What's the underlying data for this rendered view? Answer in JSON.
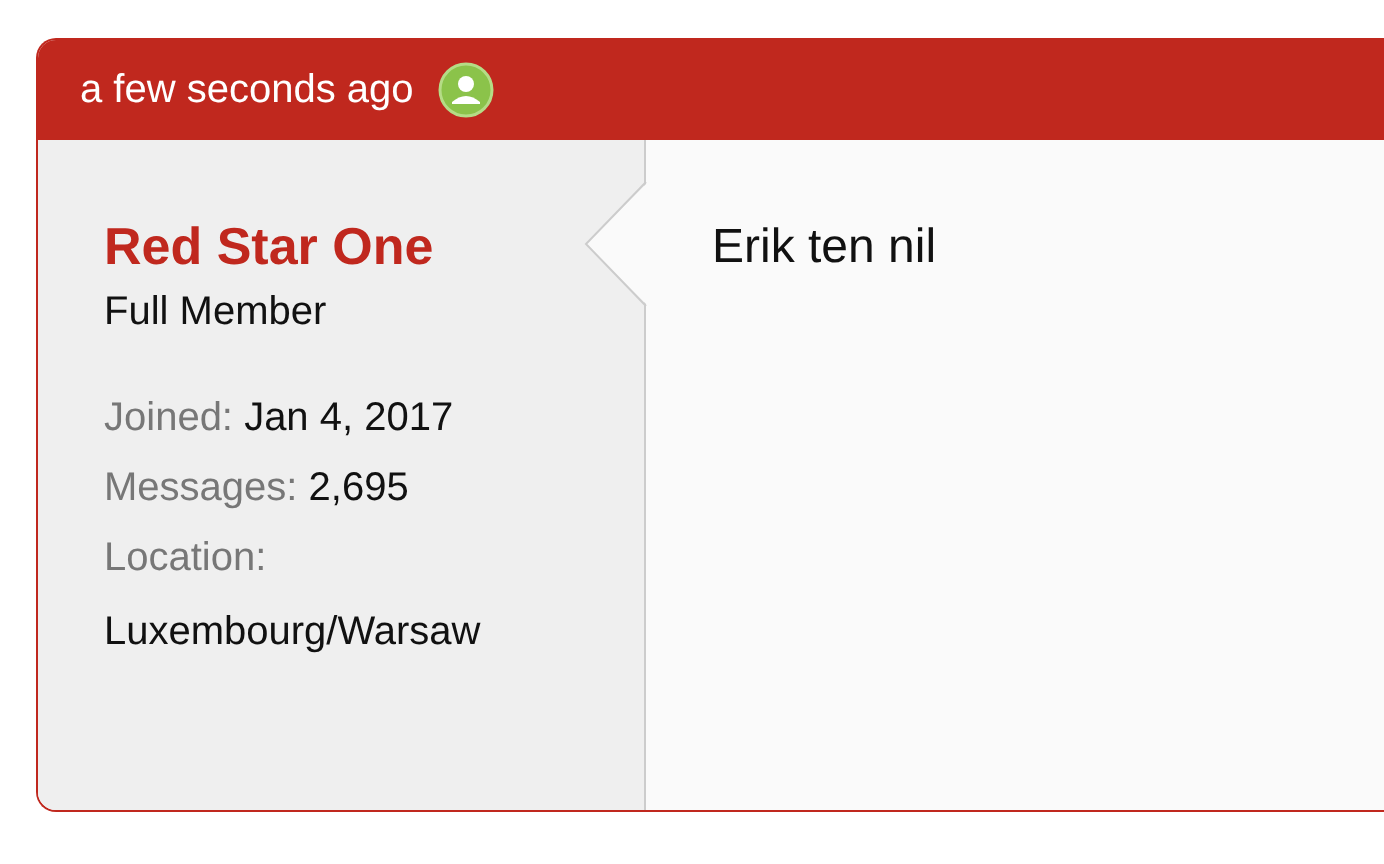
{
  "post": {
    "time": "a few seconds ago",
    "author": {
      "name": "Red Star One",
      "title": "Full Member",
      "stats": [
        {
          "label": "Joined:",
          "value": "Jan 4, 2017",
          "kind": "inline"
        },
        {
          "label": "Messages:",
          "value": "2,695",
          "kind": "inline"
        },
        {
          "label": "Location:",
          "value": "Luxembourg/Warsaw",
          "kind": "block"
        }
      ]
    },
    "message": "Erik ten nil"
  }
}
